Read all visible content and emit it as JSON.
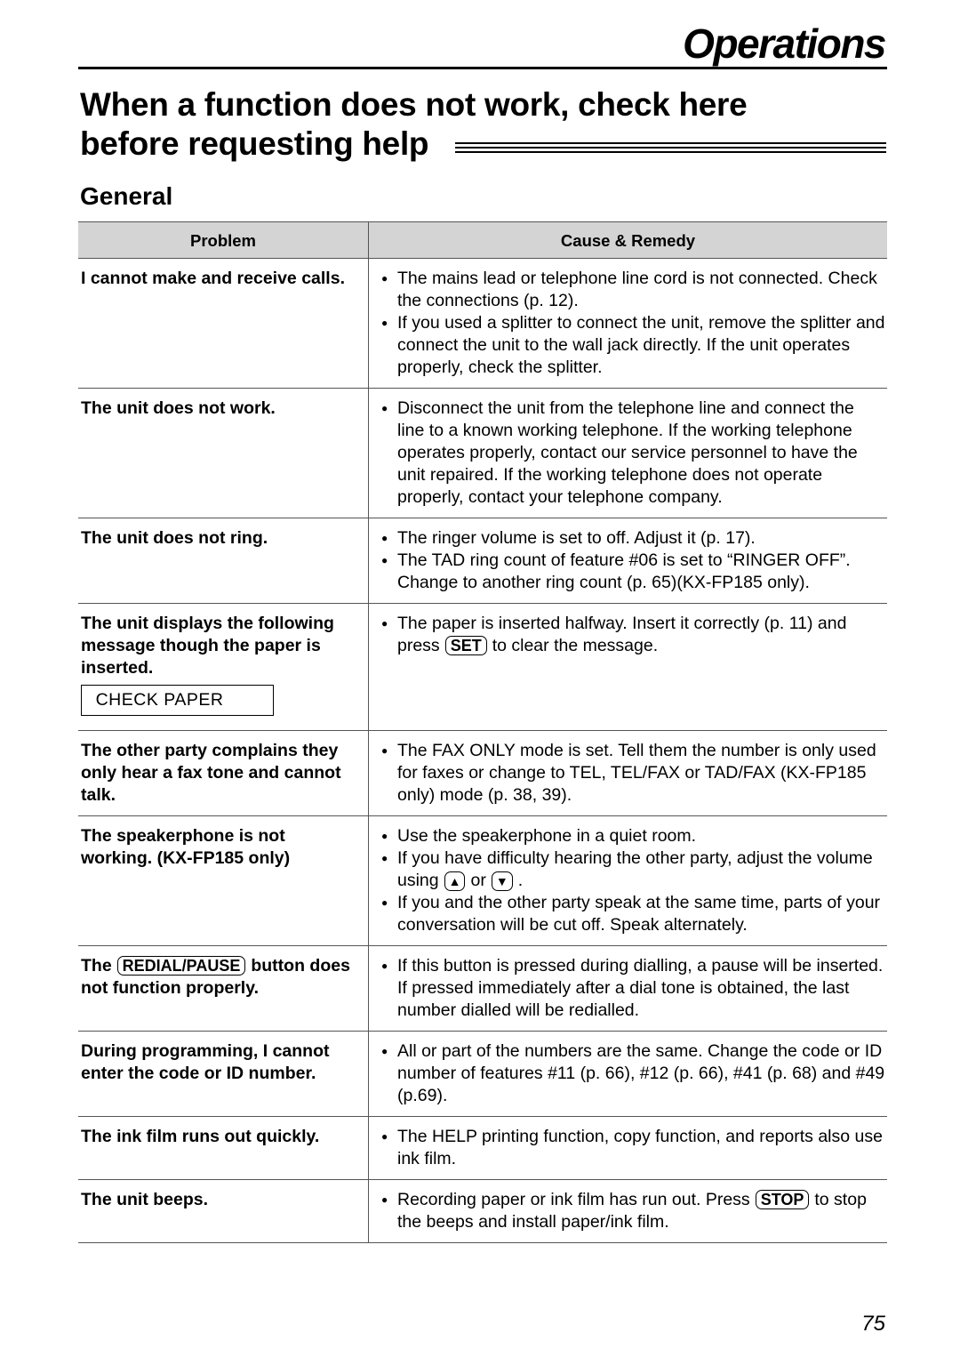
{
  "page": {
    "section_title": "Operations",
    "heading_line1": "When a function does not work, check here",
    "heading_line2": "before requesting help",
    "subheading": "General",
    "page_number": "75"
  },
  "table": {
    "headers": {
      "problem": "Problem",
      "remedy": "Cause & Remedy"
    },
    "rows": [
      {
        "problem": "I cannot make and receive calls.",
        "remedies": [
          "The mains lead or telephone line cord is not connected. Check the connections (p. 12).",
          "If you used a splitter to connect the unit, remove the splitter and connect the unit to the wall jack directly. If the unit operates properly, check the splitter."
        ]
      },
      {
        "problem": "The unit does not work.",
        "remedies": [
          "Disconnect the unit from the telephone line and connect the line to a known working telephone. If the working telephone operates properly, contact our service personnel to have the unit repaired. If the working telephone does not operate properly, contact your telephone company."
        ]
      },
      {
        "problem": "The unit does not ring.",
        "remedies": [
          "The ringer volume is set to off. Adjust it (p. 17).",
          "The TAD ring count of feature #06 is set to “RINGER OFF”. Change to another ring count (p. 65)(KX-FP185 only)."
        ]
      },
      {
        "problem": "The unit displays the following message though the paper is inserted.",
        "display_message": "CHECK  PAPER",
        "remedy_before_key": "The paper is inserted halfway. Insert it correctly (p. 11) and press",
        "remedy_key": "SET",
        "remedy_after_key": "to clear the message."
      },
      {
        "problem": "The other party complains they only hear a fax tone and cannot talk.",
        "remedies": [
          "The FAX ONLY mode is set. Tell them the number is only used for faxes or change to TEL, TEL/FAX or TAD/FAX (KX-FP185 only) mode (p. 38, 39)."
        ]
      },
      {
        "problem": "The speakerphone is not working. (KX-FP185 only)",
        "remedy_1": "Use the speakerphone in a quiet room.",
        "remedy_2_before": "If you have difficulty hearing the other party, adjust the volume using",
        "remedy_2_key_up": "▲",
        "remedy_2_mid": "or",
        "remedy_2_key_down": "▼",
        "remedy_2_after": ".",
        "remedy_3": "If you and the other party speak at the same time, parts of your conversation will be cut off. Speak alternately."
      },
      {
        "problem_before_key": "The",
        "problem_key": "REDIAL/PAUSE",
        "problem_after_key": "button does not function properly.",
        "remedies": [
          "If this button is pressed during dialling, a pause will be inserted. If pressed immediately after a dial tone is obtained, the last number dialled will be redialled."
        ]
      },
      {
        "problem": "During programming, I cannot enter the code or ID number.",
        "remedies": [
          "All or part of the numbers are the same. Change the code or ID number of features #11 (p. 66), #12 (p. 66), #41 (p. 68) and #49 (p.69)."
        ]
      },
      {
        "problem": "The ink film runs out quickly.",
        "remedies": [
          "The HELP printing function, copy function, and reports also use ink film."
        ]
      },
      {
        "problem": "The unit beeps.",
        "remedy_before_key": "Recording paper or ink film has run out. Press",
        "remedy_key": "STOP",
        "remedy_after_key": "to stop the beeps and install paper/ink film."
      }
    ]
  }
}
